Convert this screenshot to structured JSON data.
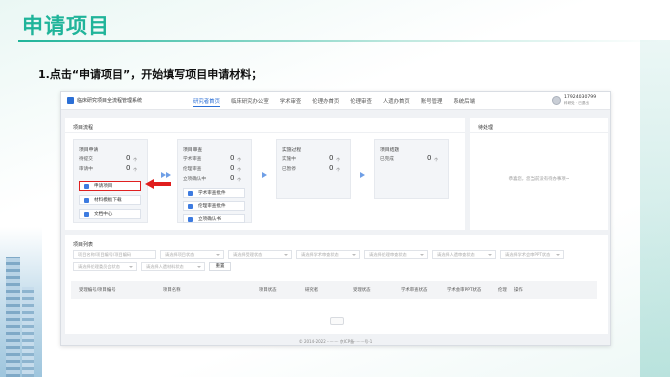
{
  "slide": {
    "title": "申请项目",
    "step": "1.点击“申请项目”，开始填写项目申请材料；"
  },
  "app": {
    "name": "临床研究项目全流程管理系统",
    "nav": [
      {
        "label": "研究者首页",
        "active": true
      },
      {
        "label": "临床研究办公室",
        "active": false
      },
      {
        "label": "学术审查",
        "active": false
      },
      {
        "label": "伦理办首页",
        "active": false
      },
      {
        "label": "伦理审查",
        "active": false
      },
      {
        "label": "人遗办首页",
        "active": false
      },
      {
        "label": "账号管理",
        "active": false
      },
      {
        "label": "系统后端",
        "active": false
      }
    ],
    "user": {
      "phone": "17924030799",
      "sub": "科研处 · 已退出"
    },
    "colors": {
      "accent": "#2b6fd6",
      "highlight": "#e01d1d",
      "brand": "#20b49a"
    }
  },
  "flow": {
    "title": "项目流程",
    "apply": {
      "title": "项目申请",
      "rows": [
        {
          "label": "待提交",
          "value": "0",
          "unit": "个"
        },
        {
          "label": "审请中",
          "value": "0",
          "unit": "个"
        }
      ],
      "buttons": [
        "申请项目",
        "材料模板下载",
        "文档中心"
      ]
    },
    "review": {
      "title": "项目审查",
      "rows": [
        {
          "label": "学术审查",
          "value": "0",
          "unit": "个"
        },
        {
          "label": "伦理审查",
          "value": "0",
          "unit": "个"
        },
        {
          "label": "立项确认中",
          "value": "0",
          "unit": "个"
        }
      ],
      "buttons": [
        "学术审查批件",
        "伦理审查批件",
        "立项确认书"
      ]
    },
    "impl": {
      "title": "实施过程",
      "rows": [
        {
          "label": "实施中",
          "value": "0",
          "unit": "个"
        },
        {
          "label": "已暂停",
          "value": "0",
          "unit": "个"
        }
      ]
    },
    "end": {
      "title": "项目结题",
      "rows": [
        {
          "label": "已完成",
          "value": "0",
          "unit": "个"
        }
      ]
    }
  },
  "todo": {
    "title": "待处理",
    "empty": "恭喜您，您当前没有待办事项~"
  },
  "list": {
    "title": "项目列表",
    "filters": [
      "项目名称/项目编号/项目编码",
      "请选择项目状态",
      "请选择受理状态",
      "请选择学术审查状态",
      "请选择伦理审查状态",
      "请选择人遗审查状态",
      "请选择学术会审PPT状态",
      "请选择伦理委员会状态",
      "请选择人遗材料状态"
    ],
    "reset": "重置",
    "columns": [
      "受理编号/项目编号",
      "项目名称",
      "项目状态",
      "研究者",
      "受理状态",
      "学术审查状态",
      "学术会审PPT状态",
      "伦理",
      "操作"
    ]
  },
  "footer": "© 2014-2022 ········· 京ICP备········号-1"
}
